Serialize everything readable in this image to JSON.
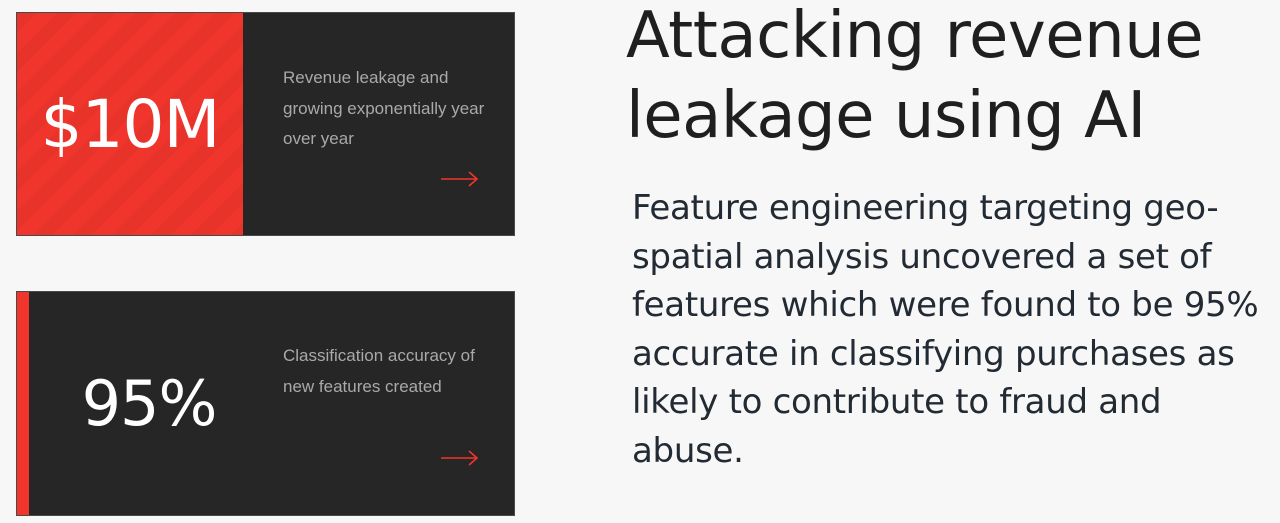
{
  "cards": [
    {
      "stat": "$10M",
      "description": "Revenue leakage and growing exponentially year over year",
      "arrow_icon": "arrow-right-icon"
    },
    {
      "stat": "95%",
      "description": "Classification accuracy of new features created",
      "arrow_icon": "arrow-right-icon"
    }
  ],
  "headline": "Attacking revenue leakage using AI",
  "body": "Feature engineering targeting geo-spatial analysis uncovered a set of features which were found to be 95% accurate in classifying purchases as likely to contribute to fraud and abuse.",
  "colors": {
    "accent": "#f0352c",
    "card_bg": "#262626",
    "page_bg": "#f7f7f7",
    "desc_text": "#a9a9a9"
  }
}
